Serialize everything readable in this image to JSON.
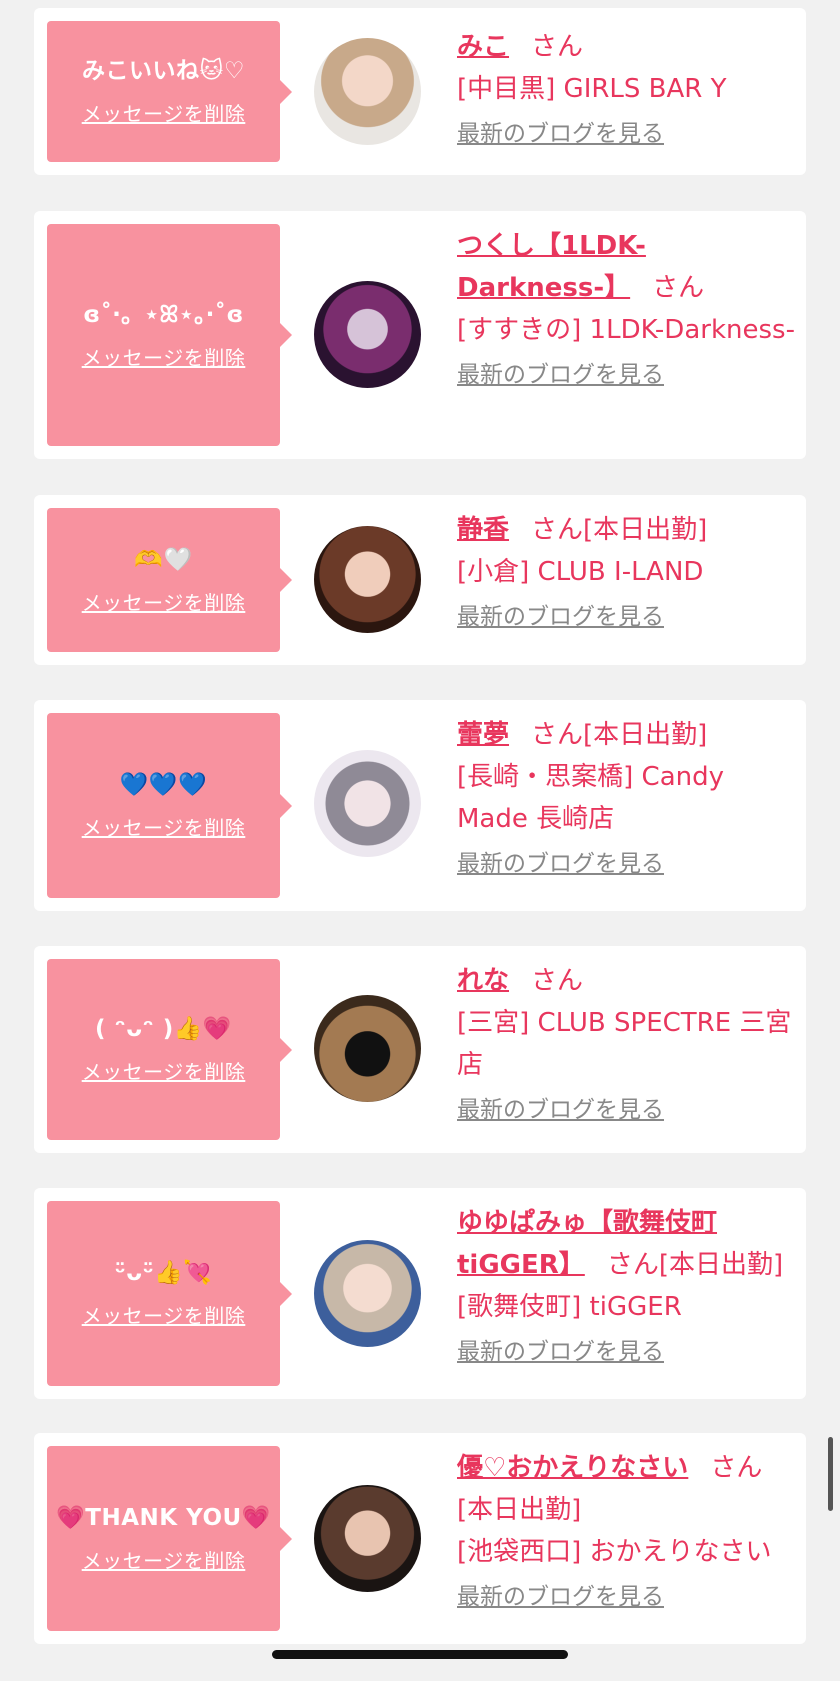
{
  "delete_label": "メッセージを削除",
  "blog_label": "最新のブログを見る",
  "san_label": "さん",
  "cards": [
    {
      "message": "みこいいね🐱♡",
      "name": "みこ",
      "status": "",
      "shop": "[中目黒] GIRLS BAR Y"
    },
    {
      "message": "ɞ˚‧。⋆ꕤ⋆。‧˚ɞ",
      "name": "つくし【1LDK-Darkness-】",
      "status": "",
      "shop": "[すすきの] 1LDK-Darkness-"
    },
    {
      "message": "🫶🤍",
      "name": "静香",
      "status": "[本日出勤]",
      "shop": "[小倉] CLUB I-LAND"
    },
    {
      "message": "💙💙💙",
      "name": "蕾夢",
      "status": "[本日出勤]",
      "shop": "[長崎・思案橋] Candy Made 長崎店"
    },
    {
      "message": "( ᵔᴗᵔ )👍💗",
      "name": "れな",
      "status": "",
      "shop": "[三宮] CLUB SPECTRE 三宮店"
    },
    {
      "message": "ᵕ̈ᴗᵕ̈👍💘",
      "name": "ゆゆぱみゅ【歌舞伎町tiGGER】",
      "status": "[本日出勤]",
      "shop": "[歌舞伎町] tiGGER"
    },
    {
      "message": "💗THANK YOU💗",
      "name": "優♡おかえりなさい",
      "status": "[本日出勤]",
      "shop": "[池袋西口] おかえりなさい"
    }
  ],
  "colors": {
    "accent": "#e8365d",
    "bubble": "#f8929f",
    "link_gray": "#888888",
    "background": "#f1f1f1"
  }
}
